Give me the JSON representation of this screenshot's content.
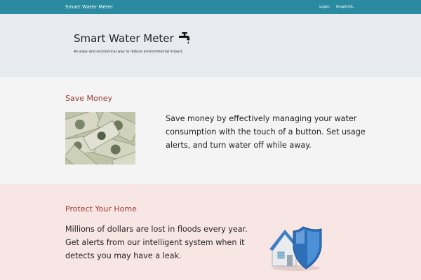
{
  "navbar": {
    "brand": "Smart Water Meter",
    "links": [
      {
        "label": "Login"
      },
      {
        "label": "GraphiQL"
      }
    ]
  },
  "hero": {
    "title": "Smart Water Meter",
    "subtitle": "An easy and economical way to reduce environmental impact.",
    "icon": "faucet-icon"
  },
  "sections": {
    "money": {
      "heading": "Save Money",
      "text": "Save money by effectively managing your water consumption with the touch of a button. Set usage alerts, and turn water off while away.",
      "image": "money-bills-image"
    },
    "home": {
      "heading": "Protect Your Home",
      "text": "Millions of dollars are lost in floods every year. Get alerts from our intelligent system when it detects you may have a leak.",
      "image": "house-shield-image"
    }
  },
  "colors": {
    "navbar": "#2a8aa0",
    "hero_bg": "#e7ebef",
    "section_gray": "#f4f4f4",
    "section_pink": "#f8e6e4",
    "heading_accent": "#9a3a30"
  }
}
